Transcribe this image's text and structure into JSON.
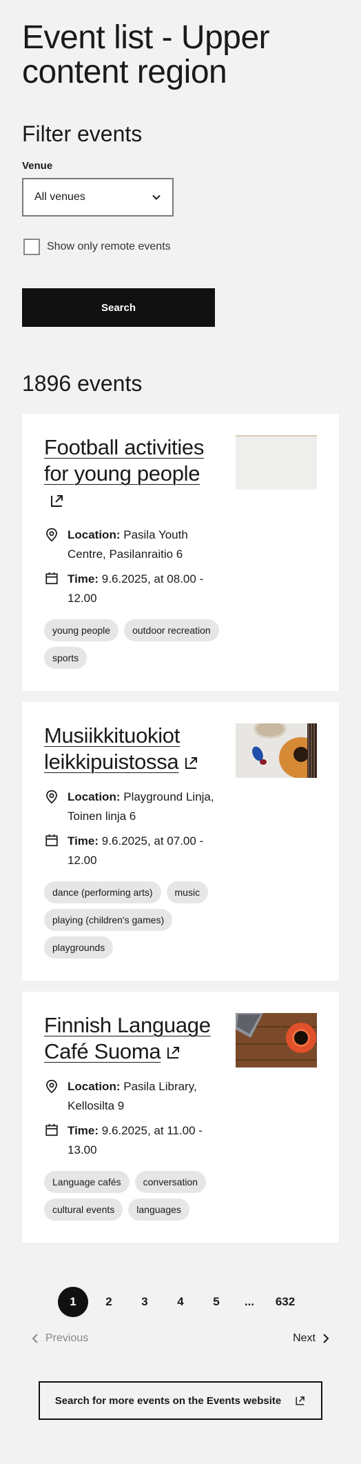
{
  "page": {
    "title": "Event list - Upper content region"
  },
  "filter": {
    "title": "Filter events",
    "venue_label": "Venue",
    "venue_value": "All venues",
    "remote_label": "Show only remote events",
    "remote_checked": false,
    "search_label": "Search"
  },
  "results": {
    "count_text": "1896 events"
  },
  "events": [
    {
      "title": "Football activities for young people",
      "location_label": "Location:",
      "location": "Pasila Youth Centre, Pasilanraitio 6",
      "time_label": "Time:",
      "time": "9.6.2025, at 08.00 - 12.00",
      "tags": [
        "young people",
        "outdoor recreation",
        "sports"
      ]
    },
    {
      "title": "Musiikkituokiot leikkipuistossa",
      "location_label": "Location:",
      "location": "Playground Linja, Toinen linja 6",
      "time_label": "Time:",
      "time": "9.6.2025, at 07.00 - 12.00",
      "tags": [
        "dance (performing arts)",
        "music",
        "playing (children's games)",
        "playgrounds"
      ]
    },
    {
      "title": "Finnish Language Café Suoma",
      "location_label": "Location:",
      "location": "Pasila Library, Kellosilta 9",
      "time_label": "Time:",
      "time": "9.6.2025, at 11.00 - 13.00",
      "tags": [
        "Language cafés",
        "conversation",
        "cultural events",
        "languages"
      ]
    }
  ],
  "pagination": {
    "pages": [
      "1",
      "2",
      "3",
      "4",
      "5",
      "...",
      "632"
    ],
    "current": "1",
    "previous_label": "Previous",
    "next_label": "Next"
  },
  "more": {
    "label": "Search for more events on the Events website"
  },
  "icons": {
    "location": "location-pin-icon",
    "time": "calendar-icon",
    "external": "external-link-icon",
    "dropdown": "chevron-down-icon"
  },
  "colors": {
    "background": "#f2f2f2",
    "card": "#ffffff",
    "primary": "#111111",
    "tag": "#e6e6e6",
    "muted": "#888888"
  }
}
